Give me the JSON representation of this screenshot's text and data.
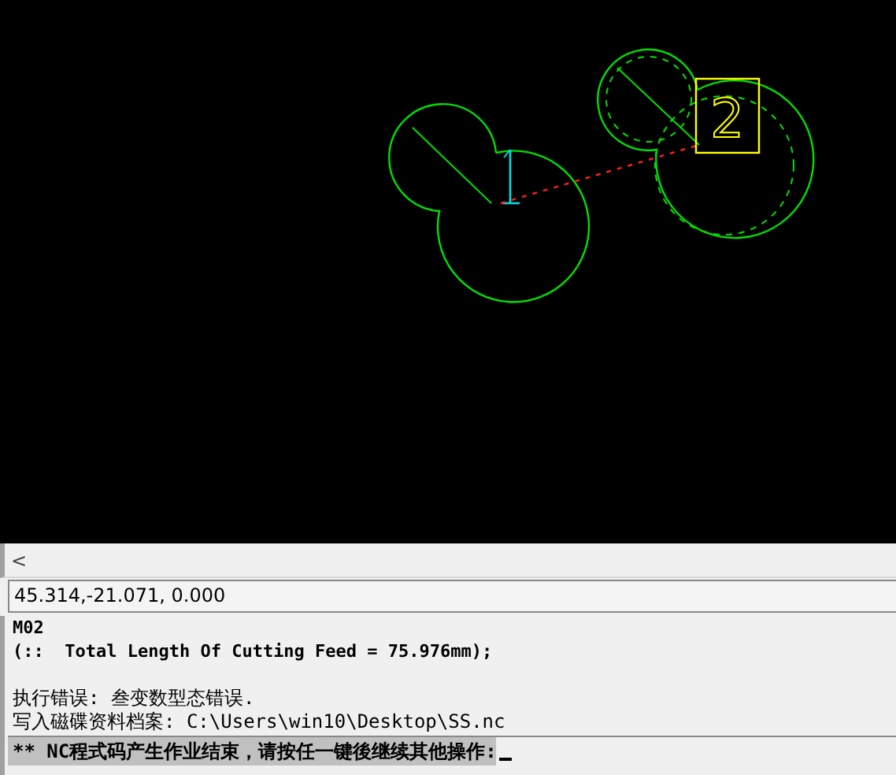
{
  "canvas": {
    "tool_label": "2"
  },
  "scroll_bar": {
    "left_arrow": "<"
  },
  "coordinates": "45.314,-21.071, 0.000",
  "console": {
    "lines": [
      {
        "kind": "code",
        "text": "M02"
      },
      {
        "kind": "code",
        "text": "(::  Total Length Of Cutting Feed = 75.976mm);"
      },
      {
        "kind": "blank"
      },
      {
        "kind": "message",
        "text": "执行错误: 叁变数型态错误."
      },
      {
        "kind": "message",
        "text": "写入磁碟资料档案: C:\\Users\\win10\\Desktop\\SS.nc"
      }
    ],
    "prompt": "** NC程式码产生作业结束，请按任一键後继续其他操作:"
  }
}
